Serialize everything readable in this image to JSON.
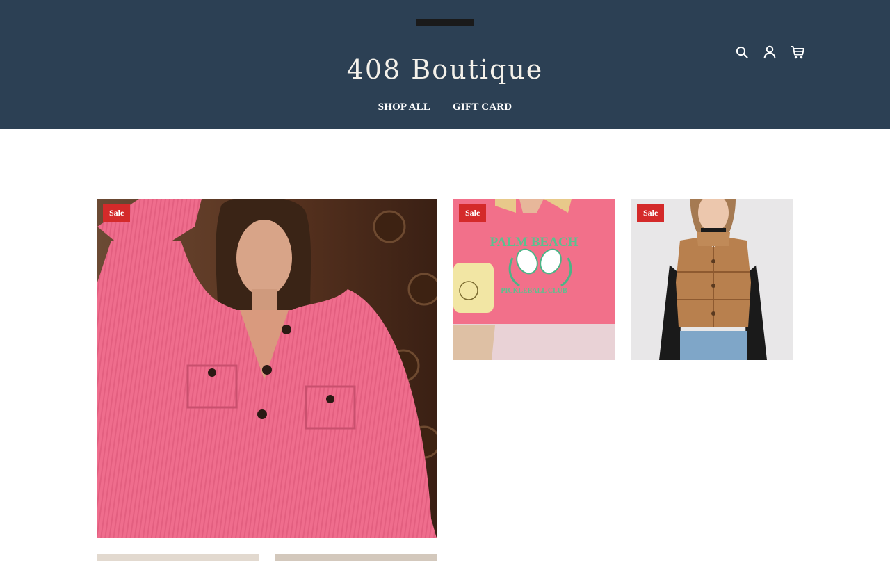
{
  "store": {
    "name": "408 Boutique"
  },
  "nav": {
    "items": [
      "SHOP ALL",
      "GIFT CARD"
    ]
  },
  "header_icons": [
    "search-icon",
    "account-icon",
    "cart-icon"
  ],
  "colors": {
    "header_bg": "#2c4054",
    "sale_badge": "#d42a2a",
    "text_light": "#ffffff"
  },
  "products": [
    {
      "badge": "Sale",
      "image": "pink ribbed pullover with collar and buttons"
    },
    {
      "badge": "Sale",
      "image": "pink sweatshirt with pickleball print",
      "print_text": [
        "PALM BEACH",
        "PICKLEBALL CLUB"
      ]
    },
    {
      "badge": "Sale",
      "image": "tan faux leather cropped puffer vest"
    }
  ]
}
